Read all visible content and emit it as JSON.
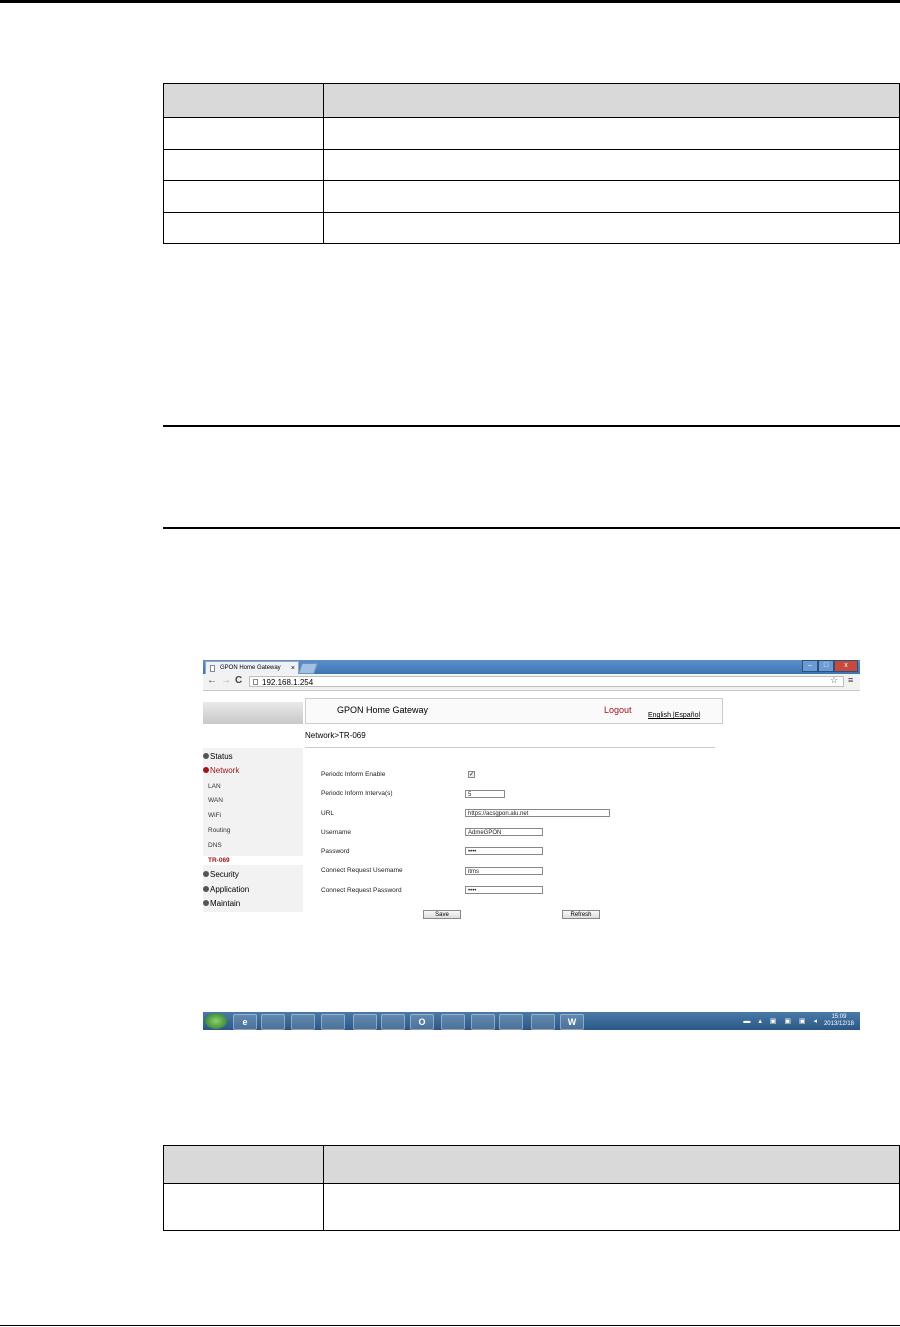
{
  "table1": {
    "rows": [
      "",
      "",
      "",
      ""
    ]
  },
  "browser": {
    "tab_title": "GPON Home Gateway",
    "tab_close": "×",
    "address": "192.168.1.254",
    "back": "←",
    "forward": "→",
    "reload": "C",
    "star": "☆",
    "menu": "≡",
    "win_minimize": "–",
    "win_maximize": "□",
    "win_close": "x"
  },
  "header": {
    "brand": "GPON Home Gateway",
    "logout": "Logout",
    "lang": "English |Español"
  },
  "breadcrumb": "Network>TR-069",
  "sidebar": {
    "status": "Status",
    "network": "Network",
    "items": [
      "LAN",
      "WAN",
      "WiFi",
      "Routing",
      "DNS",
      "TR-069"
    ],
    "security": "Security",
    "application": "Application",
    "maintain": "Maintain"
  },
  "form": {
    "periodic_enable_label": "Periodc Inform Enable",
    "periodic_enable_check": "✓",
    "periodic_interval_label": "Periodc Inform Interva(s)",
    "periodic_interval_value": "5",
    "url_label": "URL",
    "url_value": "https://acsgpon.alu.net",
    "username_label": "Username",
    "username_value": "AdmeGPON",
    "password_label": "Password",
    "password_value": "••••",
    "cr_username_label": "Connect Request Usemame",
    "cr_username_value": "itms",
    "cr_password_label": "Connect Request Password",
    "cr_password_value": "••••",
    "save": "Save",
    "refresh": "Refresh"
  },
  "taskbar": {
    "icons": [
      "",
      "e",
      "",
      "",
      "",
      "",
      "",
      "O",
      "",
      "",
      "",
      "",
      "W"
    ],
    "tray": "▬ ▴ ▣ ▣ ▣ ◂",
    "time": "15:09",
    "date": "2013/12/18"
  }
}
